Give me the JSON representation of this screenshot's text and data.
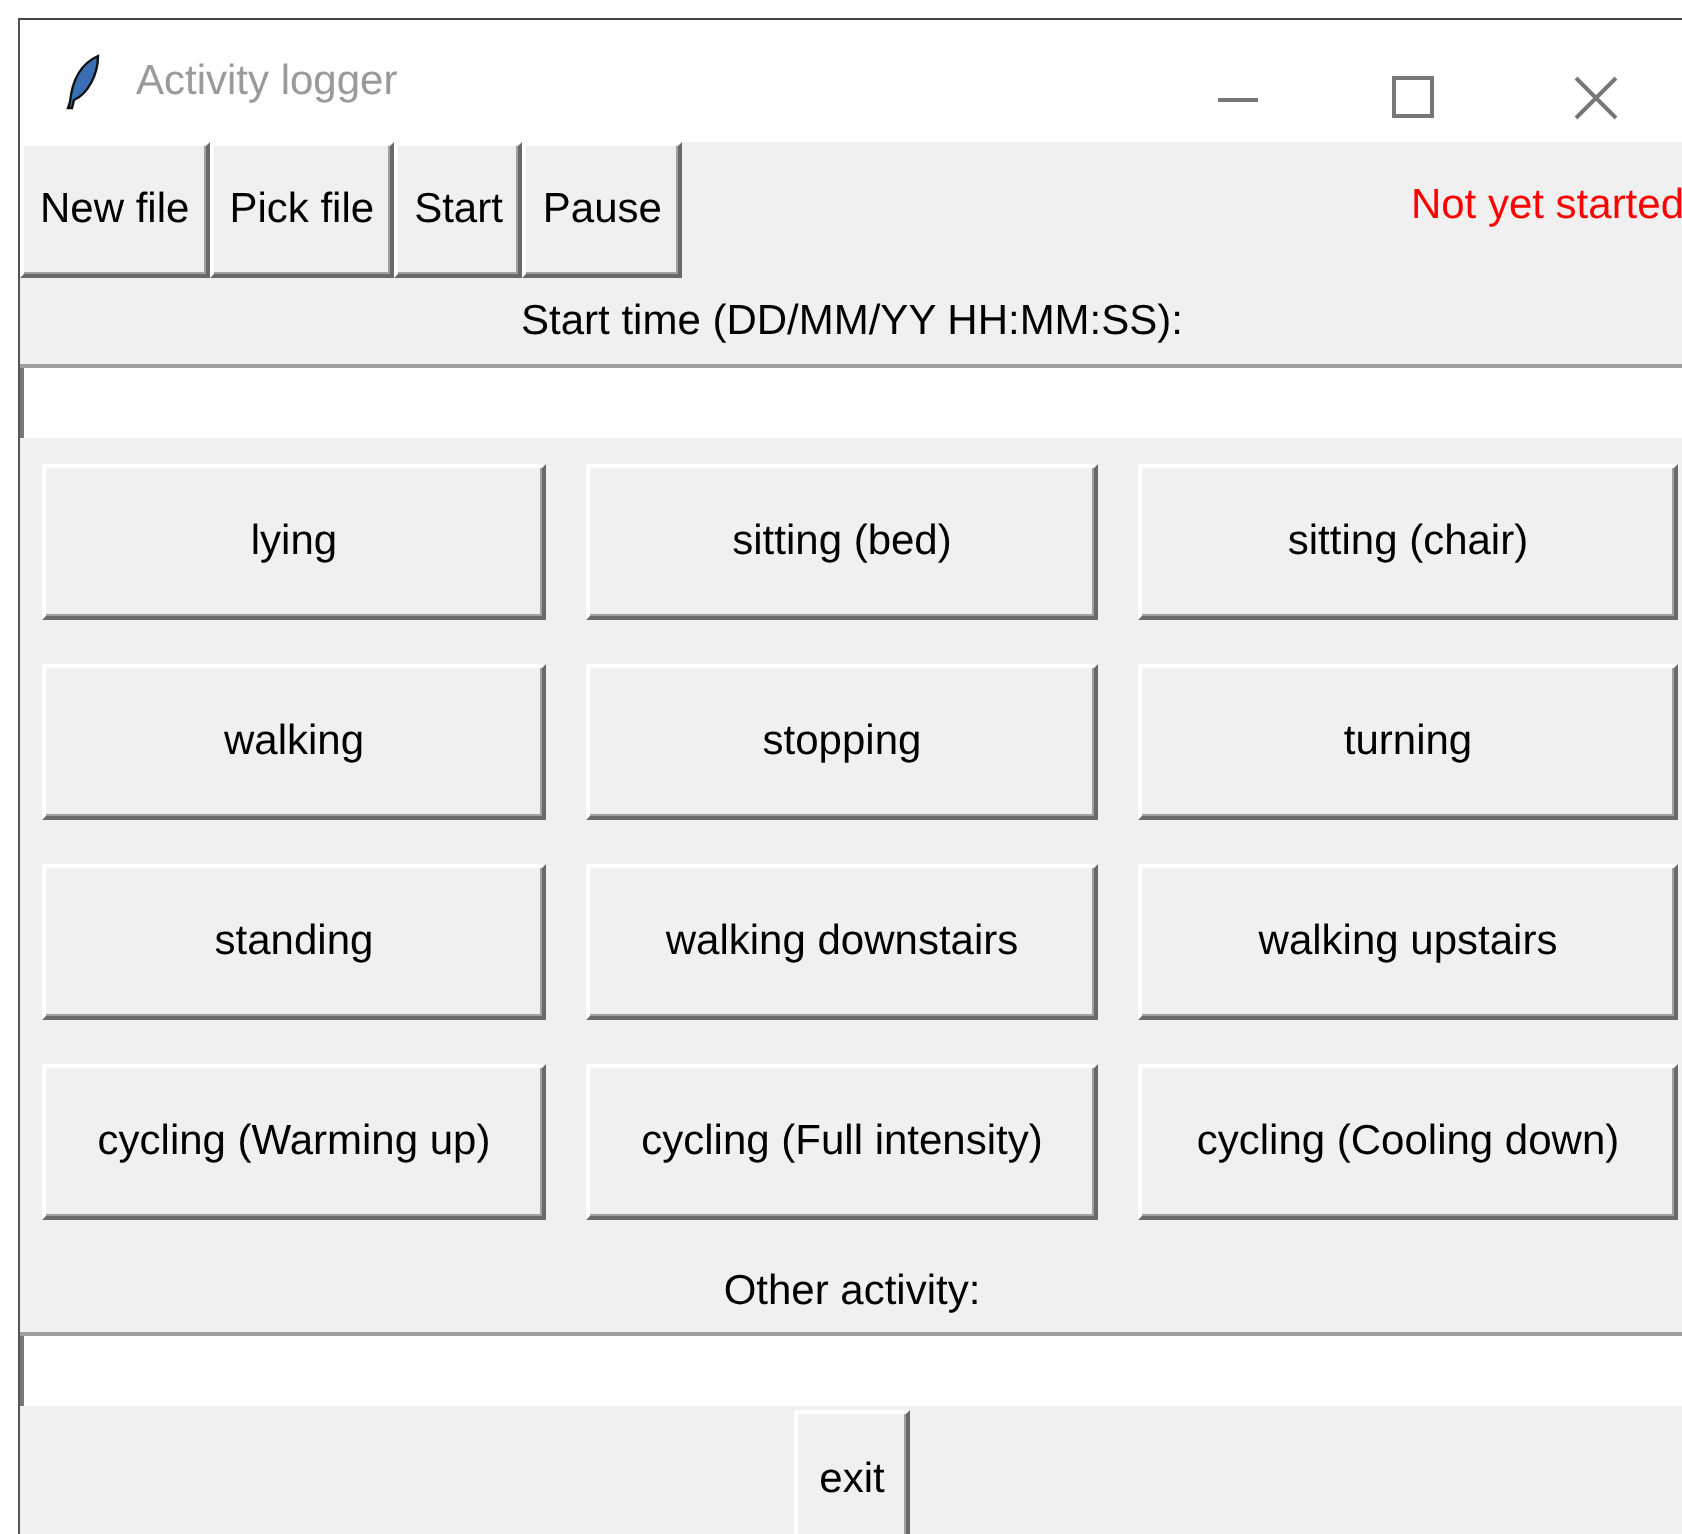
{
  "window": {
    "title": "Activity logger"
  },
  "toolbar": {
    "buttons": [
      "New file",
      "Pick file",
      "Start",
      "Pause"
    ],
    "status": "Not yet started"
  },
  "start_time": {
    "label": "Start time (DD/MM/YY HH:MM:SS):"
  },
  "activities": [
    "lying",
    "sitting (bed)",
    "sitting (chair)",
    "walking",
    "stopping",
    "turning",
    "standing",
    "walking downstairs",
    "walking upstairs",
    "cycling (Warming up)",
    "cycling (Full intensity)",
    "cycling (Cooling down)"
  ],
  "other_activity": {
    "label": "Other activity:"
  },
  "exit_button": "exit"
}
